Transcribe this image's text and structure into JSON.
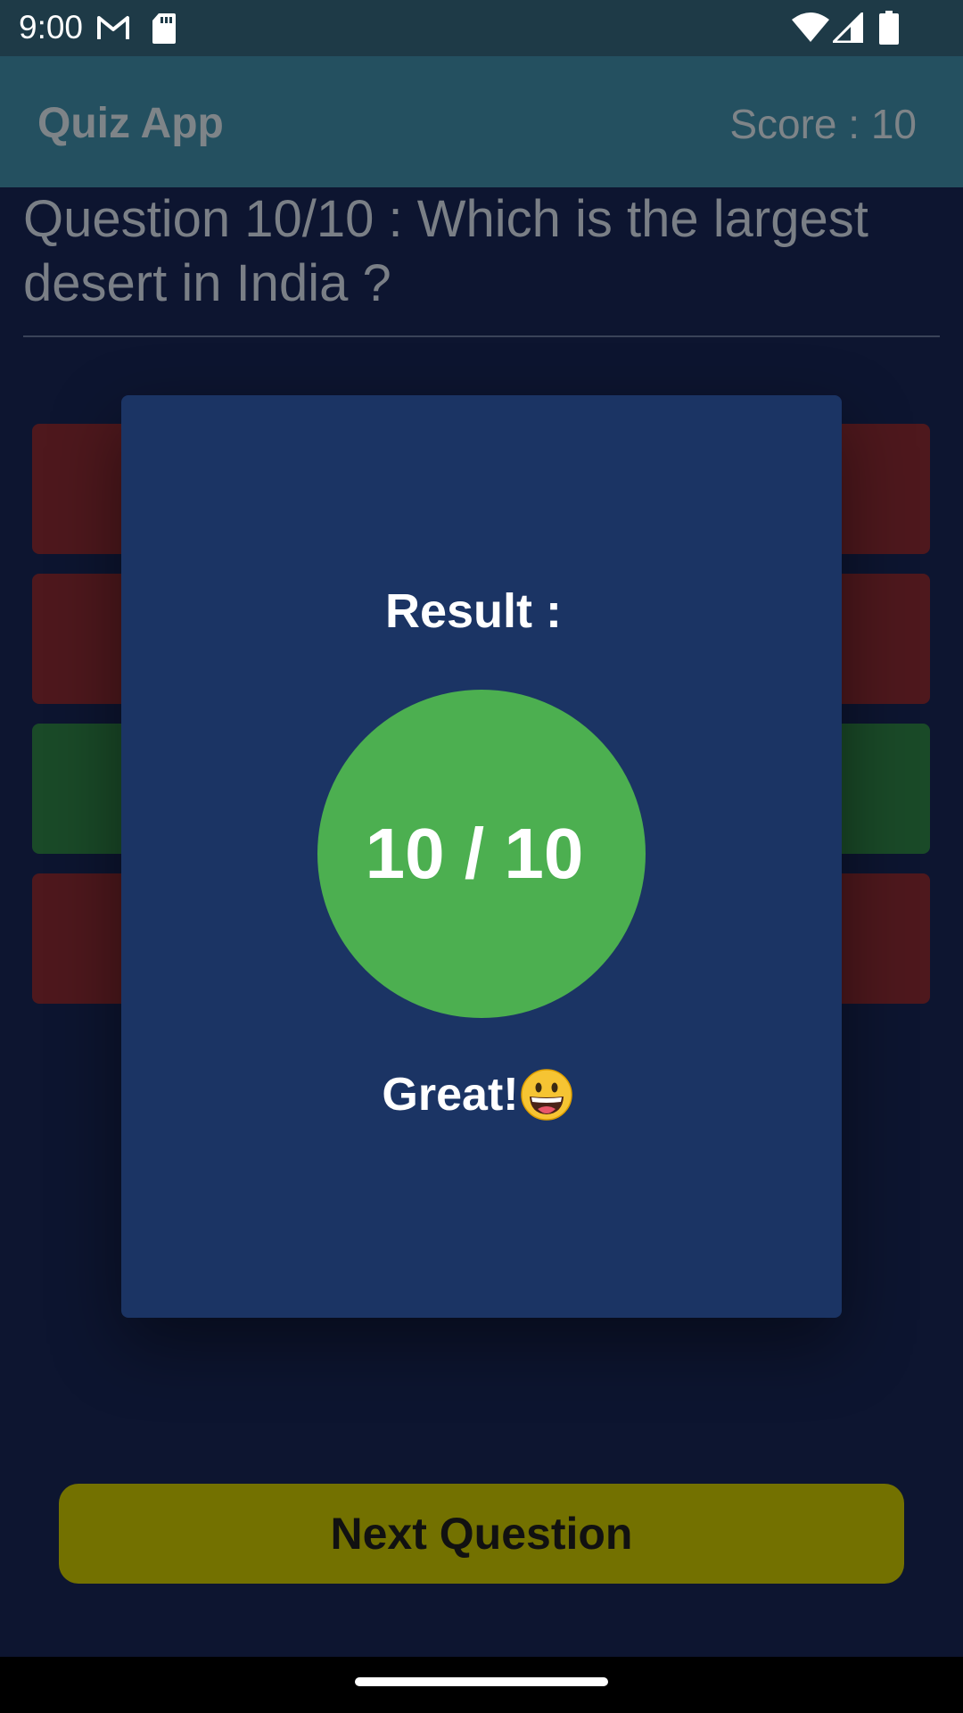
{
  "status_bar": {
    "time": "9:00",
    "icons": [
      "gmail-icon",
      "sd-card-icon",
      "wifi-icon",
      "cell-signal-icon",
      "battery-icon"
    ]
  },
  "app_bar": {
    "title": "Quiz App",
    "score": "Score : 10"
  },
  "question": {
    "text": "Question 10/10 : Which is the largest desert in India ?"
  },
  "options": [
    {
      "state": "wrong",
      "color": "#4e181d"
    },
    {
      "state": "wrong",
      "color": "#4e181d"
    },
    {
      "state": "correct",
      "color": "#1a4a28"
    },
    {
      "state": "wrong",
      "color": "#4e181d"
    }
  ],
  "dialog": {
    "result_label": "Result :",
    "score": "10 / 10",
    "feedback": "Great!",
    "feedback_icon": "grinning-face-icon"
  },
  "next_button": {
    "label": "Next Question"
  },
  "colors": {
    "dialog_bg": "#1b3464",
    "score_circle": "#4caf50",
    "next_button": "#737100",
    "app_bar": "#245060"
  }
}
